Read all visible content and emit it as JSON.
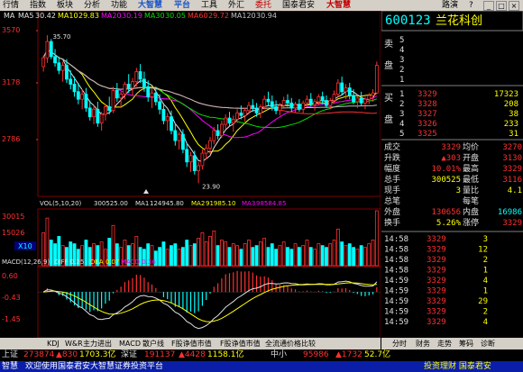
{
  "menu": {
    "items": [
      "行情",
      "指数",
      "板块",
      "分析",
      "功能",
      "大智慧",
      "平台",
      "工具",
      "外汇",
      "委托",
      "国泰君安"
    ],
    "logo": "大智慧",
    "right": [
      "路演",
      "?"
    ]
  },
  "price_chart": {
    "ma_title": "MA",
    "ma_labels": [
      {
        "name": "MA5",
        "value": "30.42",
        "color": "#e0e0e0"
      },
      {
        "name": "MA10",
        "value": "29.83",
        "color": "#ffff00"
      },
      {
        "name": "MA20",
        "value": "30.19",
        "color": "#ff00ff"
      },
      {
        "name": "MA30",
        "value": "30.05",
        "color": "#00e000"
      },
      {
        "name": "MA60",
        "value": "29.72",
        "color": "#ff3030"
      },
      {
        "name": "MA120",
        "value": "30.94",
        "color": "#c0c0c0"
      }
    ],
    "y_ticks": [
      "3570",
      "3178",
      "2786"
    ],
    "high_label": "35.70",
    "low_label": "23.90",
    "ylim": [
      23.0,
      36.5
    ],
    "candles": [
      [
        33.2,
        34.1,
        32.8,
        33.9
      ],
      [
        33.9,
        35.7,
        33.5,
        35.2
      ],
      [
        35.2,
        35.4,
        33.8,
        34.0
      ],
      [
        34.0,
        34.6,
        33.2,
        33.5
      ],
      [
        33.5,
        34.0,
        32.6,
        32.9
      ],
      [
        32.9,
        33.6,
        32.0,
        33.3
      ],
      [
        33.3,
        33.8,
        31.9,
        32.2
      ],
      [
        32.2,
        32.9,
        31.4,
        31.8
      ],
      [
        31.8,
        32.4,
        30.8,
        31.2
      ],
      [
        31.2,
        31.9,
        30.2,
        30.6
      ],
      [
        30.6,
        31.4,
        29.8,
        31.0
      ],
      [
        31.0,
        31.5,
        29.6,
        29.9
      ],
      [
        29.9,
        30.5,
        28.9,
        29.2
      ],
      [
        29.2,
        30.1,
        28.6,
        29.8
      ],
      [
        29.8,
        30.4,
        28.4,
        28.7
      ],
      [
        28.7,
        29.6,
        28.1,
        29.4
      ],
      [
        29.4,
        30.2,
        28.9,
        30.0
      ],
      [
        30.0,
        30.8,
        29.4,
        29.7
      ],
      [
        29.7,
        31.6,
        29.5,
        31.3
      ],
      [
        31.3,
        31.9,
        30.4,
        30.7
      ],
      [
        30.7,
        31.2,
        29.9,
        31.0
      ],
      [
        31.0,
        32.0,
        30.6,
        31.8
      ],
      [
        31.8,
        32.6,
        31.1,
        31.5
      ],
      [
        31.5,
        32.3,
        30.9,
        32.0
      ],
      [
        32.0,
        33.1,
        31.6,
        32.8
      ],
      [
        32.8,
        33.4,
        31.9,
        32.2
      ],
      [
        32.2,
        32.8,
        31.2,
        31.6
      ],
      [
        31.6,
        32.1,
        30.4,
        30.8
      ],
      [
        30.8,
        31.4,
        29.9,
        31.1
      ],
      [
        31.1,
        31.6,
        30.1,
        30.4
      ],
      [
        30.4,
        31.0,
        29.4,
        29.8
      ],
      [
        29.8,
        30.3,
        28.6,
        28.9
      ],
      [
        28.9,
        29.5,
        28.1,
        29.2
      ],
      [
        29.2,
        29.7,
        27.8,
        28.1
      ],
      [
        28.1,
        28.7,
        26.9,
        27.3
      ],
      [
        27.3,
        28.0,
        26.6,
        27.8
      ],
      [
        27.8,
        28.2,
        26.3,
        26.6
      ],
      [
        26.6,
        27.1,
        25.2,
        25.6
      ],
      [
        25.6,
        26.4,
        24.8,
        26.1
      ],
      [
        26.1,
        26.5,
        24.6,
        24.9
      ],
      [
        24.9,
        25.6,
        23.9,
        25.3
      ],
      [
        25.3,
        26.6,
        25.0,
        26.3
      ],
      [
        26.3,
        27.0,
        25.8,
        26.7
      ],
      [
        26.7,
        27.6,
        26.2,
        27.3
      ],
      [
        27.3,
        28.4,
        27.0,
        28.1
      ],
      [
        28.1,
        28.6,
        27.4,
        27.7
      ],
      [
        27.7,
        28.9,
        27.5,
        28.6
      ],
      [
        28.6,
        29.4,
        28.2,
        29.1
      ],
      [
        29.1,
        29.6,
        28.4,
        28.7
      ],
      [
        28.7,
        29.3,
        28.0,
        29.0
      ],
      [
        29.0,
        29.8,
        28.7,
        29.5
      ],
      [
        29.5,
        30.1,
        29.0,
        29.3
      ],
      [
        29.3,
        29.9,
        28.8,
        29.7
      ],
      [
        29.7,
        30.4,
        29.4,
        30.1
      ],
      [
        30.1,
        30.6,
        29.6,
        29.9
      ],
      [
        29.9,
        30.3,
        29.2,
        29.5
      ],
      [
        29.5,
        30.2,
        29.1,
        30.0
      ],
      [
        30.0,
        30.9,
        29.8,
        30.6
      ],
      [
        30.6,
        31.2,
        30.1,
        30.4
      ],
      [
        30.4,
        30.9,
        29.7,
        30.0
      ],
      [
        30.0,
        30.5,
        29.4,
        29.7
      ],
      [
        29.7,
        30.3,
        29.3,
        30.1
      ],
      [
        30.1,
        30.8,
        29.9,
        30.5
      ],
      [
        30.5,
        31.0,
        30.0,
        30.3
      ],
      [
        30.3,
        30.7,
        29.6,
        29.9
      ],
      [
        29.9,
        30.4,
        29.5,
        30.2
      ],
      [
        30.2,
        30.6,
        29.6,
        29.8
      ],
      [
        29.8,
        30.5,
        29.5,
        30.3
      ],
      [
        30.3,
        30.9,
        30.0,
        30.6
      ],
      [
        30.6,
        31.1,
        30.0,
        30.2
      ],
      [
        30.2,
        30.6,
        29.7,
        30.4
      ],
      [
        30.4,
        31.0,
        30.1,
        30.8
      ],
      [
        30.8,
        31.2,
        30.2,
        30.5
      ],
      [
        30.5,
        30.9,
        29.9,
        30.1
      ],
      [
        30.1,
        30.7,
        29.8,
        30.5
      ],
      [
        30.5,
        31.3,
        30.3,
        31.0
      ],
      [
        31.0,
        32.2,
        30.8,
        31.9
      ],
      [
        31.9,
        32.4,
        30.9,
        31.2
      ],
      [
        31.2,
        31.8,
        30.6,
        31.5
      ],
      [
        31.5,
        31.9,
        30.6,
        30.9
      ],
      [
        30.9,
        31.4,
        30.2,
        30.4
      ],
      [
        30.4,
        30.9,
        29.9,
        30.7
      ],
      [
        30.7,
        31.2,
        30.1,
        30.3
      ],
      [
        30.3,
        30.8,
        29.8,
        30.6
      ],
      [
        30.6,
        31.1,
        30.2,
        30.9
      ],
      [
        30.9,
        31.4,
        30.4,
        31.1
      ],
      [
        31.1,
        33.6,
        31.0,
        33.3
      ]
    ]
  },
  "volume_chart": {
    "label": "VOL(5,10,20)",
    "value": "300525.00",
    "ma_labels": [
      {
        "name": "MA1",
        "value": "124945.80",
        "color": "#e0e0e0"
      },
      {
        "name": "MA2",
        "value": "91985.10",
        "color": "#ffff00"
      },
      {
        "name": "MA3",
        "value": "98584.85",
        "color": "#ff00ff"
      }
    ],
    "y_ticks": [
      "30015",
      "15026"
    ],
    "unit": "X10",
    "max": 30015,
    "volumes": [
      18,
      26,
      14,
      12,
      16,
      11,
      10,
      13,
      12,
      9,
      11,
      14,
      10,
      12,
      11,
      13,
      9,
      15,
      22,
      12,
      10,
      14,
      11,
      12,
      16,
      10,
      9,
      12,
      11,
      8,
      10,
      13,
      9,
      11,
      12,
      9,
      10,
      14,
      11,
      12,
      15,
      18,
      13,
      16,
      19,
      11,
      14,
      13,
      10,
      12,
      11,
      9,
      12,
      14,
      10,
      11,
      13,
      15,
      10,
      12,
      9,
      11,
      13,
      10,
      9,
      12,
      10,
      11,
      14,
      10,
      9,
      12,
      11,
      10,
      12,
      14,
      20,
      13,
      11,
      12,
      10,
      9,
      11,
      10,
      12,
      14,
      30
    ]
  },
  "macd_chart": {
    "label": "MACD(12,26,9)",
    "diff": "DIFF 0.25",
    "dea": "DEA 0.07",
    "macd": "MACD 0.36",
    "y_ticks": [
      "0.60",
      "-0.43",
      "-1.45"
    ],
    "ylim": [
      -1.9,
      1.0
    ]
  },
  "stock": {
    "code": "600123",
    "name": "兰花科创",
    "ask_side": "卖",
    "ask_side2": "盘",
    "bid_side": "买",
    "bid_side2": "盘",
    "asks": [
      {
        "level": "5",
        "price": "",
        "vol": ""
      },
      {
        "level": "4",
        "price": "",
        "vol": ""
      },
      {
        "level": "3",
        "price": "",
        "vol": ""
      },
      {
        "level": "2",
        "price": "",
        "vol": ""
      },
      {
        "level": "1",
        "price": "",
        "vol": ""
      }
    ],
    "bids": [
      {
        "level": "1",
        "price": "3329",
        "vol": "17323"
      },
      {
        "level": "2",
        "price": "3328",
        "vol": "208"
      },
      {
        "level": "3",
        "price": "3327",
        "vol": "38"
      },
      {
        "level": "4",
        "price": "3326",
        "vol": "233"
      },
      {
        "level": "5",
        "price": "3325",
        "vol": "31"
      }
    ],
    "stats": [
      {
        "l1": "成交",
        "v1": "3329",
        "l2": "均价",
        "v2": "3270"
      },
      {
        "l1": "升跌",
        "v1": "▲303",
        "l2": "开盘",
        "v2": "3130"
      },
      {
        "l1": "幅度",
        "v1": "10.01%",
        "l2": "最高",
        "v2": "3329"
      },
      {
        "l1": "总手",
        "v1": "300525",
        "l2": "最低",
        "v2": "3116"
      },
      {
        "l1": "现手",
        "v1": "3",
        "l2": "量比",
        "v2": "4.1"
      },
      {
        "l1": "总笔",
        "v1": "",
        "l2": "每笔",
        "v2": ""
      },
      {
        "l1": "外盘",
        "v1": "130656",
        "l2": "内盘",
        "v2": "16986"
      },
      {
        "l1": "换手",
        "v1": "5.26%",
        "l2": "涨停",
        "v2": "3329"
      }
    ],
    "ticks": [
      {
        "time": "14:58",
        "price": "3329",
        "vol": "3"
      },
      {
        "time": "14:58",
        "price": "3329",
        "vol": "12"
      },
      {
        "time": "14:58",
        "price": "3329",
        "vol": "2"
      },
      {
        "time": "14:58",
        "price": "3329",
        "vol": "1"
      },
      {
        "time": "14:59",
        "price": "3329",
        "vol": "4"
      },
      {
        "time": "14:59",
        "price": "3329",
        "vol": "1"
      },
      {
        "time": "14:59",
        "price": "3329",
        "vol": "29"
      },
      {
        "time": "14:59",
        "price": "3329",
        "vol": "2"
      },
      {
        "time": "14:59",
        "price": "3329",
        "vol": "4"
      }
    ],
    "tabs": [
      "分时",
      "财务",
      "走势",
      "筹码",
      "诊断"
    ]
  },
  "indicator_tabs": [
    "KDJ",
    "W&R",
    "主力进出",
    "MACD",
    "散户线",
    "F股诤值市值",
    "F股诤值市值",
    "全流通价格比较"
  ],
  "ticker": [
    {
      "text": "上证",
      "color": "#e0e0e0"
    },
    {
      "text": "273874",
      "color": "#ff3030"
    },
    {
      "text": "▲830",
      "color": "#ff3030"
    },
    {
      "text": "1703.3亿",
      "color": "#ffff00"
    },
    {
      "text": "深证",
      "color": "#e0e0e0"
    },
    {
      "text": "191137",
      "color": "#ff3030"
    },
    {
      "text": "▲4428",
      "color": "#ff3030"
    },
    {
      "text": "1158.1亿",
      "color": "#ffff00"
    },
    {
      "text": "中小",
      "color": "#e0e0e0"
    },
    {
      "text": "95986",
      "color": "#ff3030"
    },
    {
      "text": "▲1732",
      "color": "#ff3030"
    },
    {
      "text": "52.7亿",
      "color": "#ffff00"
    }
  ],
  "status": {
    "left": "智慧",
    "message": "欢迎使用国泰君安大智慧证券投资平台",
    "right": "投资理财 国泰君安"
  }
}
